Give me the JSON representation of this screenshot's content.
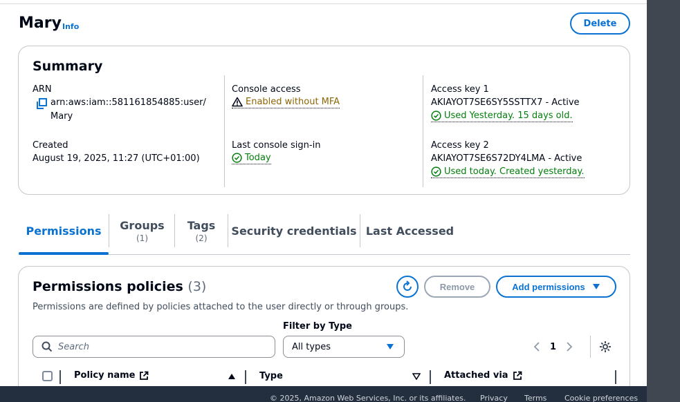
{
  "header": {
    "title": "Mary",
    "info_label": "Info",
    "delete_label": "Delete"
  },
  "summary": {
    "title": "Summary",
    "arn_label": "ARN",
    "arn_line1": "arn:aws:iam::581161854885:user/",
    "arn_line2": "Mary",
    "created_label": "Created",
    "created_value": "August 19, 2025, 11:27 (UTC+01:00)",
    "console_access_label": "Console access",
    "console_access_value": "Enabled without MFA",
    "last_signin_label": "Last console sign-in",
    "last_signin_value": "Today",
    "access_key1_label": "Access key 1",
    "access_key1_value": "AKIAYOT7SE6SY5SSTTX7 - Active",
    "access_key1_status": "Used Yesterday. 15 days old.",
    "access_key2_label": "Access key 2",
    "access_key2_value": "AKIAYOT7SE6S72DY4LMA - Active",
    "access_key2_status": "Used today. Created yesterday."
  },
  "tabs": [
    {
      "label": "Permissions",
      "count": ""
    },
    {
      "label": "Groups",
      "count": "(1)"
    },
    {
      "label": "Tags",
      "count": "(2)"
    },
    {
      "label": "Security credentials",
      "count": ""
    },
    {
      "label": "Last Accessed",
      "count": ""
    }
  ],
  "permissions": {
    "title": "Permissions policies",
    "count": "(3)",
    "description": "Permissions are defined by policies attached to the user directly or through groups.",
    "remove_label": "Remove",
    "add_label": "Add permissions",
    "filter_label": "Filter by Type",
    "search_placeholder": "Search",
    "filter_value": "All types",
    "page": "1",
    "columns": {
      "policy_name": "Policy name",
      "type": "Type",
      "attached_via": "Attached via"
    }
  },
  "footer": {
    "copyright": "© 2025, Amazon Web Services, Inc. or its affiliates.",
    "privacy": "Privacy",
    "terms": "Terms",
    "cookies": "Cookie preferences"
  },
  "colors": {
    "accent": "#0972d3",
    "success": "#037f0c",
    "warning": "#8d6605",
    "footer_bg": "#232f3e"
  }
}
